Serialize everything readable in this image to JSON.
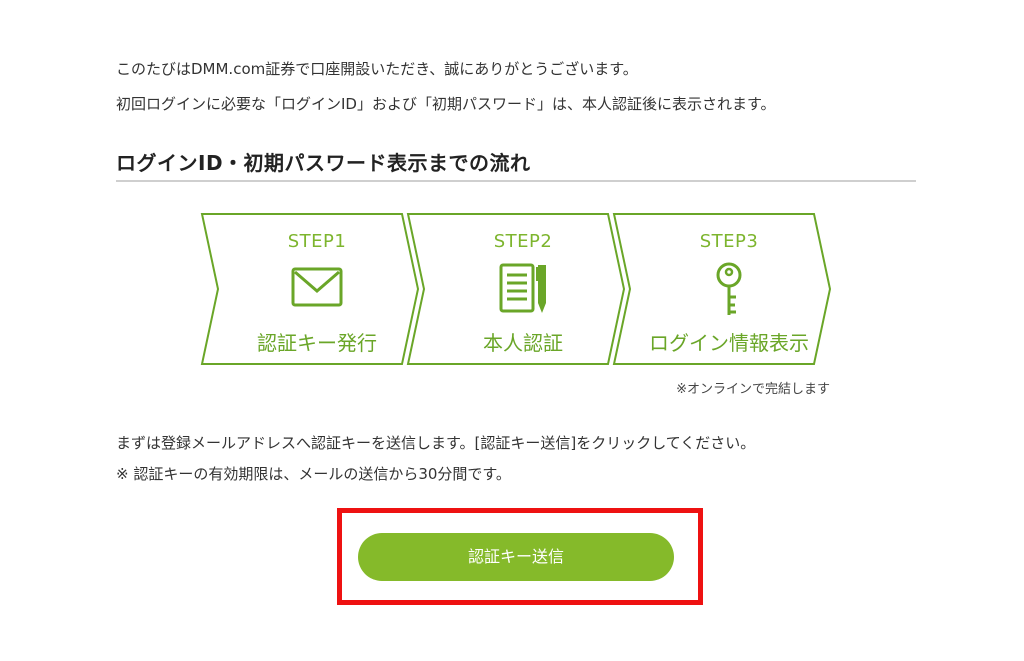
{
  "intro": {
    "line1": "このたびはDMM.com証券で口座開設いただき、誠にありがとうございます。",
    "line2": "初回ログインに必要な「ログインID」および「初期パスワード」は、本人認証後に表示されます。"
  },
  "section": {
    "title": "ログインID・初期パスワード表示までの流れ"
  },
  "steps": [
    {
      "label": "STEP1",
      "title": "認証キー発行",
      "icon": "envelope-icon"
    },
    {
      "label": "STEP2",
      "title": "本人認証",
      "icon": "document-pen-icon"
    },
    {
      "label": "STEP3",
      "title": "ログイン情報表示",
      "icon": "key-icon"
    }
  ],
  "online_note": "※オンラインで完結します",
  "instructions": {
    "line1": "まずは登録メールアドレスへ認証キーを送信します。[認証キー送信]をクリックしてください。",
    "line2": "※ 認証キーの有効期限は、メールの送信から30分間です。"
  },
  "send_button": {
    "label": "認証キー送信"
  },
  "colors": {
    "accent_green": "#85ba2a",
    "step_outline": "#6aa628",
    "highlight_red": "#ee1111"
  }
}
